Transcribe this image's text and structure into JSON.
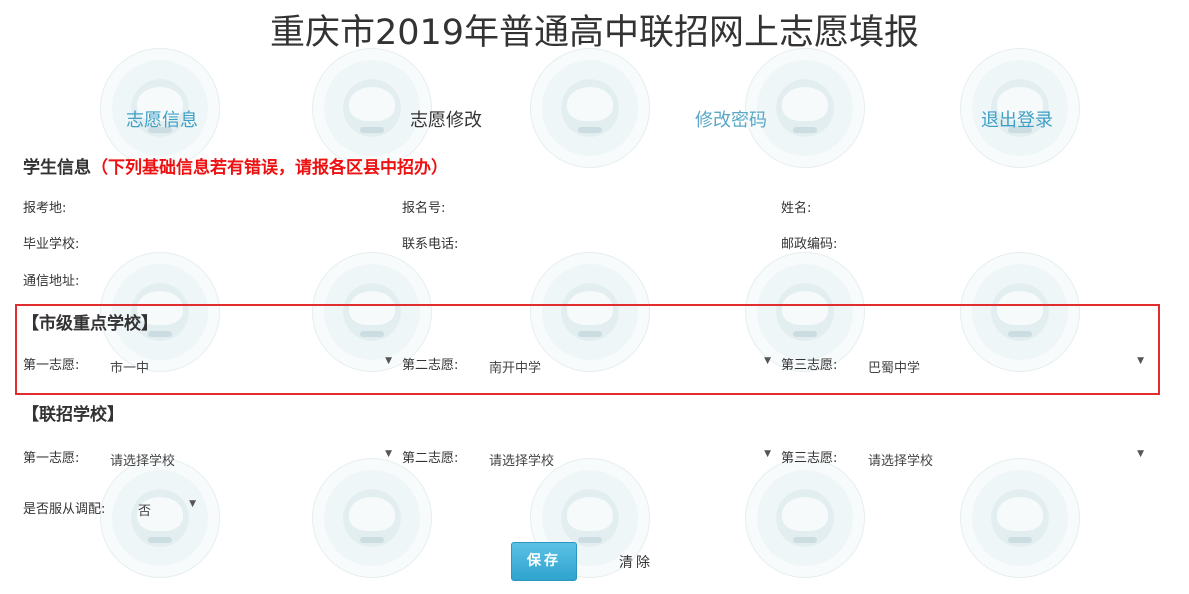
{
  "page": {
    "title": "重庆市2019年普通高中联招网上志愿填报"
  },
  "nav": [
    {
      "label": "志愿信息"
    },
    {
      "label": "志愿修改"
    },
    {
      "label": "修改密码"
    },
    {
      "label": "退出登录"
    }
  ],
  "student_info": {
    "heading": "学生信息",
    "warning": "（下列基础信息若有错误，请报各区县中招办）",
    "fields": [
      {
        "label": "报考地:"
      },
      {
        "label": "报名号:"
      },
      {
        "label": "姓名:"
      },
      {
        "label": "毕业学校:"
      },
      {
        "label": "联系电话:"
      },
      {
        "label": "邮政编码:"
      },
      {
        "label": "通信地址:"
      }
    ]
  },
  "key_schools": {
    "title": "【市级重点学校】",
    "choices": [
      {
        "label": "第一志愿:",
        "value": "市一中"
      },
      {
        "label": "第二志愿:",
        "value": "南开中学"
      },
      {
        "label": "第三志愿:",
        "value": "巴蜀中学"
      }
    ]
  },
  "joint_schools": {
    "title": "【联招学校】",
    "choices": [
      {
        "label": "第一志愿:",
        "value": "请选择学校"
      },
      {
        "label": "第二志愿:",
        "value": "请选择学校"
      },
      {
        "label": "第三志愿:",
        "value": "请选择学校"
      }
    ]
  },
  "adjust": {
    "label": "是否服从调配:",
    "value": "否"
  },
  "actions": {
    "save": "保存",
    "clear": "清除"
  },
  "icons": {
    "dropdown": "▼"
  },
  "colors": {
    "link": "#3fa0c6",
    "warning": "#ee1111",
    "highlight_box": "#e12d2d",
    "save_button": "#3aaed7"
  }
}
